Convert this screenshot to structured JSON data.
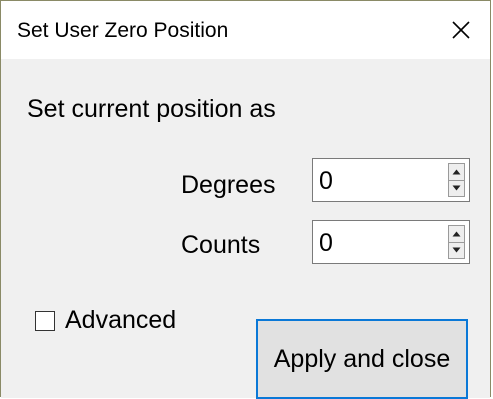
{
  "window": {
    "title": "Set User Zero Position",
    "close_icon": "close-icon"
  },
  "main": {
    "heading": "Set current position as",
    "fields": [
      {
        "label": "Degrees",
        "value": "0"
      },
      {
        "label": "Counts",
        "value": "0"
      }
    ],
    "advanced": {
      "label": "Advanced",
      "checked": false
    },
    "apply_button_label": "Apply and close"
  },
  "colors": {
    "accent_border": "#0a78d7",
    "dialog_background": "#f0f0f0",
    "titlebar_background": "#ffffff"
  }
}
